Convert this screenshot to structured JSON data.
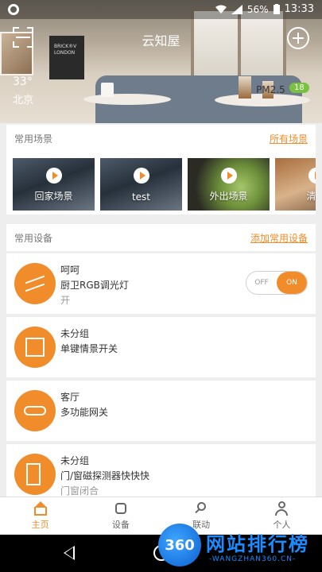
{
  "status_bar": {
    "battery": "56%",
    "time": "13:33"
  },
  "header": {
    "title": "云知屋"
  },
  "weather": {
    "temperature": "33°",
    "city": "北京",
    "pm_label": "PM2.5",
    "pm_value": "18"
  },
  "scenes_section": {
    "title": "常用场景",
    "link": "所有场景",
    "items": [
      {
        "label": "回家场景"
      },
      {
        "label": "test"
      },
      {
        "label": "外出场景"
      },
      {
        "label": "清晨"
      }
    ]
  },
  "devices_section": {
    "title": "常用设备",
    "link": "添加常用设备",
    "items": [
      {
        "group": "呵呵",
        "name": "厨卫RGB调光灯",
        "state": "开",
        "icon": "light-strip-icon",
        "toggle_off": "OFF",
        "toggle_on": "ON"
      },
      {
        "group": "未分组",
        "name": "单键情景开关",
        "state": "",
        "icon": "switch-icon"
      },
      {
        "group": "客厅",
        "name": "多功能网关",
        "state": "",
        "icon": "gateway-icon"
      },
      {
        "group": "未分组",
        "name": "门/窗磁探测器快快快",
        "state": "门窗闭合",
        "icon": "door-sensor-icon"
      }
    ]
  },
  "bottom_nav": {
    "items": [
      {
        "label": "主页",
        "icon": "home-icon"
      },
      {
        "label": "设备",
        "icon": "device-icon"
      },
      {
        "label": "联动",
        "icon": "link-icon"
      },
      {
        "label": "个人",
        "icon": "user-icon"
      }
    ]
  },
  "watermark": {
    "logo": "360",
    "title": "网站排行榜",
    "subtitle": "-WANGZHAN360.CN-"
  },
  "colors": {
    "accent": "#f08c2a",
    "pm_badge": "#7ac142"
  }
}
